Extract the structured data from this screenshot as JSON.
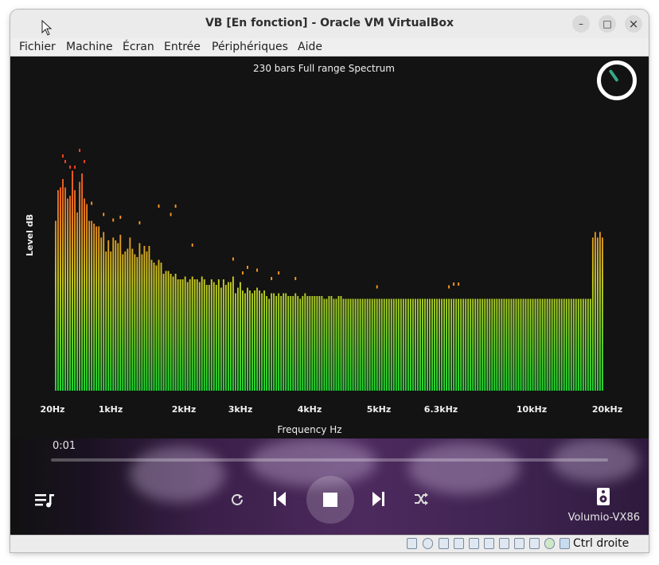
{
  "window": {
    "title": "VB [En fonction] - Oracle VM VirtualBox",
    "minimize_glyph": "–",
    "maximize_glyph": "□",
    "close_glyph": "×"
  },
  "menubar": {
    "items": [
      "Fichier",
      "Machine",
      "Écran",
      "Entrée",
      "Périphériques",
      "Aide"
    ]
  },
  "spectrum": {
    "title": "230 bars Full range Spectrum",
    "xlabel": "Frequency Hz",
    "ylabel": "Level dB",
    "xticks": [
      "20Hz",
      "1kHz",
      "2kHz",
      "3kHz",
      "4kHz",
      "5kHz",
      "6.3kHz",
      "10kHz",
      "20kHz"
    ],
    "colors": {
      "low": "#22dd33",
      "mid": "#cccc22",
      "high": "#ff4422",
      "peak": "#ff9922"
    }
  },
  "chart_data": {
    "type": "bar",
    "title": "230 bars Full range Spectrum",
    "xlabel": "Frequency Hz",
    "ylabel": "Level dB",
    "bar_count": 230,
    "x_ticks": [
      "20Hz",
      "1kHz",
      "2kHz",
      "3kHz",
      "4kHz",
      "5kHz",
      "6.3kHz",
      "10kHz",
      "20kHz"
    ],
    "series": [
      {
        "values": [
          61,
          72,
          73,
          76,
          73,
          69,
          70,
          79,
          72,
          64,
          75,
          78,
          69,
          67,
          61,
          61,
          60,
          59,
          59,
          55,
          57,
          50,
          54,
          50,
          55,
          54,
          53,
          56,
          49,
          50,
          51,
          55,
          51,
          49,
          48,
          53,
          49,
          52,
          50,
          52,
          47,
          46,
          45,
          47,
          46,
          42,
          43,
          43,
          42,
          41,
          42,
          40,
          40,
          40,
          41,
          39,
          40,
          41,
          40,
          40,
          39,
          41,
          40,
          38,
          38,
          40,
          39,
          38,
          40,
          37,
          40,
          38,
          39,
          39,
          41,
          35,
          37,
          39,
          36,
          35,
          37,
          36,
          35,
          36,
          37,
          36,
          35,
          36,
          34,
          33,
          35,
          35,
          34,
          35,
          34,
          35,
          35,
          34,
          34,
          34,
          35,
          34,
          33,
          34,
          35,
          34,
          34,
          34,
          34,
          34,
          34,
          34,
          33,
          33,
          34,
          34,
          33,
          33,
          34,
          34,
          33,
          33,
          33,
          33,
          33,
          33,
          33,
          33,
          33,
          33,
          33,
          33,
          33,
          33,
          33,
          33,
          33,
          33,
          33,
          33,
          33,
          33,
          33,
          33,
          33,
          33,
          33,
          33,
          33,
          33,
          33,
          33,
          33,
          33,
          33,
          33,
          33,
          33,
          33,
          33,
          33,
          33,
          33,
          33,
          33,
          33,
          33,
          33,
          33,
          33,
          33,
          33,
          33,
          33,
          33,
          33,
          33,
          33,
          33,
          33,
          33,
          33,
          33,
          33,
          33,
          33,
          33,
          33,
          33,
          33,
          33,
          33,
          33,
          33,
          33,
          33,
          33,
          33,
          33,
          33,
          33,
          33,
          33,
          33,
          33,
          33,
          33,
          33,
          33,
          33,
          33,
          33,
          33,
          33,
          33,
          33,
          33,
          33,
          33,
          33,
          33,
          33,
          33,
          33,
          55,
          57,
          55,
          57,
          55
        ]
      }
    ],
    "peaks": [
      [
        3,
        84
      ],
      [
        4,
        82
      ],
      [
        6,
        80
      ],
      [
        8,
        80
      ],
      [
        10,
        86
      ],
      [
        12,
        82
      ],
      [
        15,
        67
      ],
      [
        20,
        63
      ],
      [
        24,
        61
      ],
      [
        27,
        62
      ],
      [
        35,
        60
      ],
      [
        43,
        66
      ],
      [
        48,
        63
      ],
      [
        50,
        66
      ],
      [
        57,
        52
      ],
      [
        74,
        47
      ],
      [
        78,
        42
      ],
      [
        80,
        44
      ],
      [
        84,
        43
      ],
      [
        90,
        40
      ],
      [
        93,
        42
      ],
      [
        100,
        40
      ],
      [
        134,
        37
      ],
      [
        164,
        37
      ],
      [
        166,
        38
      ],
      [
        168,
        38
      ]
    ]
  },
  "player": {
    "elapsed": "0:01",
    "progress_fraction": 0.0,
    "queue_icon": "queue-music-icon",
    "repeat_icon": "repeat-icon",
    "prev_icon": "skip-previous-icon",
    "stop_icon": "stop-icon",
    "next_icon": "skip-next-icon",
    "shuffle_icon": "shuffle-icon",
    "device_name": "Volumio-VX86"
  },
  "statusbar": {
    "host_key": "Ctrl droite"
  }
}
